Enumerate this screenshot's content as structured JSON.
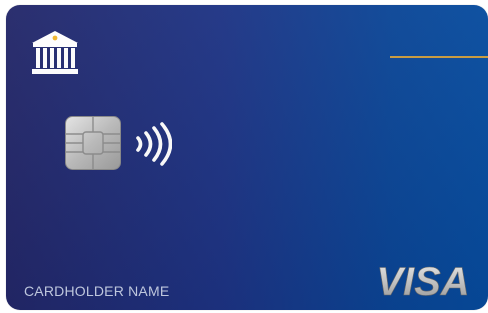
{
  "card": {
    "network": "VISA",
    "cardholder_label": "CARDHOLDER NAME"
  },
  "icons": {
    "bank": "bank-icon",
    "chip": "chip-icon",
    "contactless": "contactless-icon",
    "network_logo": "visa-logo"
  },
  "colors": {
    "card_gradient_start": "#232769",
    "card_gradient_end": "#064b9e",
    "accent_line": "#c99a3c",
    "label_text": "#c9d2ea"
  }
}
